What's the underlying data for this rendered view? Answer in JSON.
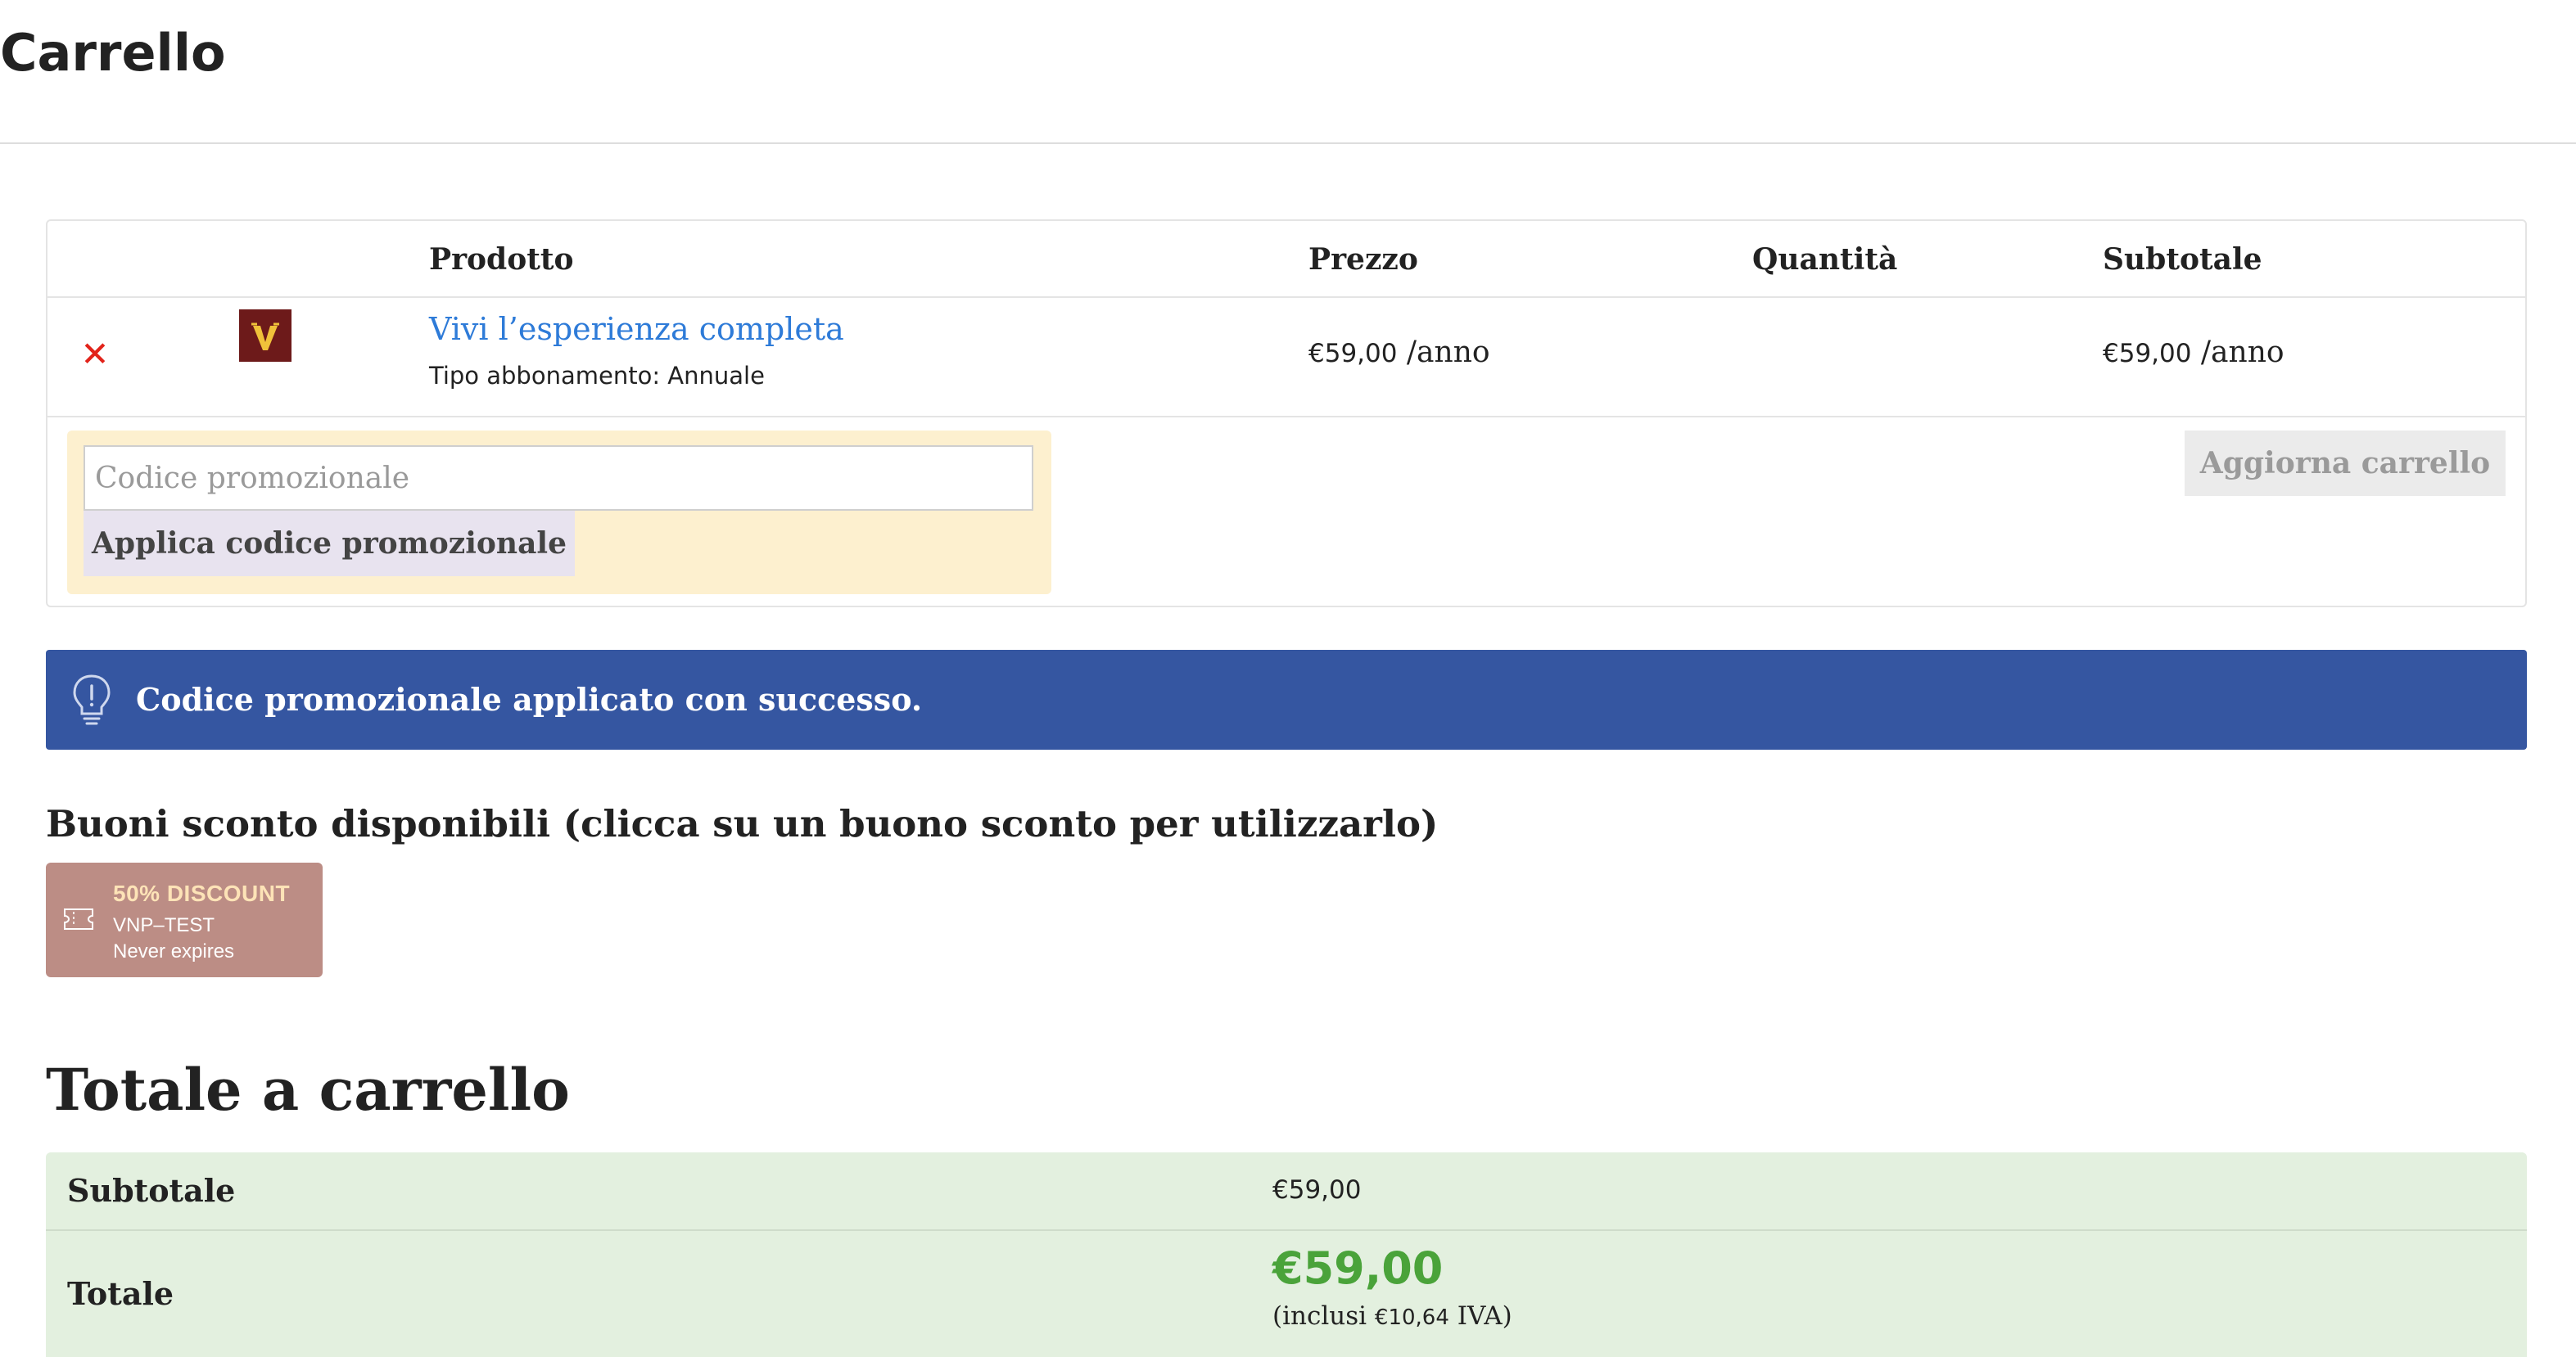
{
  "page": {
    "title": "Carrello"
  },
  "cart_table": {
    "headers": {
      "product": "Prodotto",
      "price": "Prezzo",
      "quantity": "Quantità",
      "subtotal": "Subtotale"
    },
    "items": [
      {
        "remove_icon": "close-icon",
        "thumbnail_letter": "V",
        "name": "Vivi l’esperienza completa",
        "meta": "Tipo abbonamento: Annuale",
        "price": "€59,00",
        "price_period": " /anno",
        "subtotal": "€59,00",
        "subtotal_period": " /anno"
      }
    ]
  },
  "coupon_form": {
    "placeholder": "Codice promozionale",
    "value": "",
    "apply_label": "Applica codice promozionale",
    "update_label": "Aggiorna carrello"
  },
  "notice": {
    "icon": "lightbulb-icon",
    "message": "Codice promozionale applicato con successo."
  },
  "available_coupons": {
    "heading": "Buoni sconto disponibili (clicca su un buono sconto per utilizzarlo)",
    "items": [
      {
        "icon": "ticket-icon",
        "title": "50% DISCOUNT",
        "code": "VNP–TEST",
        "expiry": "Never expires"
      }
    ]
  },
  "totals": {
    "heading": "Totale a carrello",
    "subtotal_label": "Subtotale",
    "subtotal_value": "€59,00",
    "total_label": "Totale",
    "total_value": "€59,00",
    "tax_prefix": "(inclusi ",
    "tax_amount": "€10,64",
    "tax_suffix": " IVA)"
  },
  "colors": {
    "link": "#2e7bd8",
    "remove": "#e2231a",
    "notice_bg": "#3556a1",
    "coupon_box_bg": "#fdf0cf",
    "coupon_card_bg": "#bc8d85",
    "totals_bg": "#e3f0df",
    "total_price": "#4aa33a"
  }
}
